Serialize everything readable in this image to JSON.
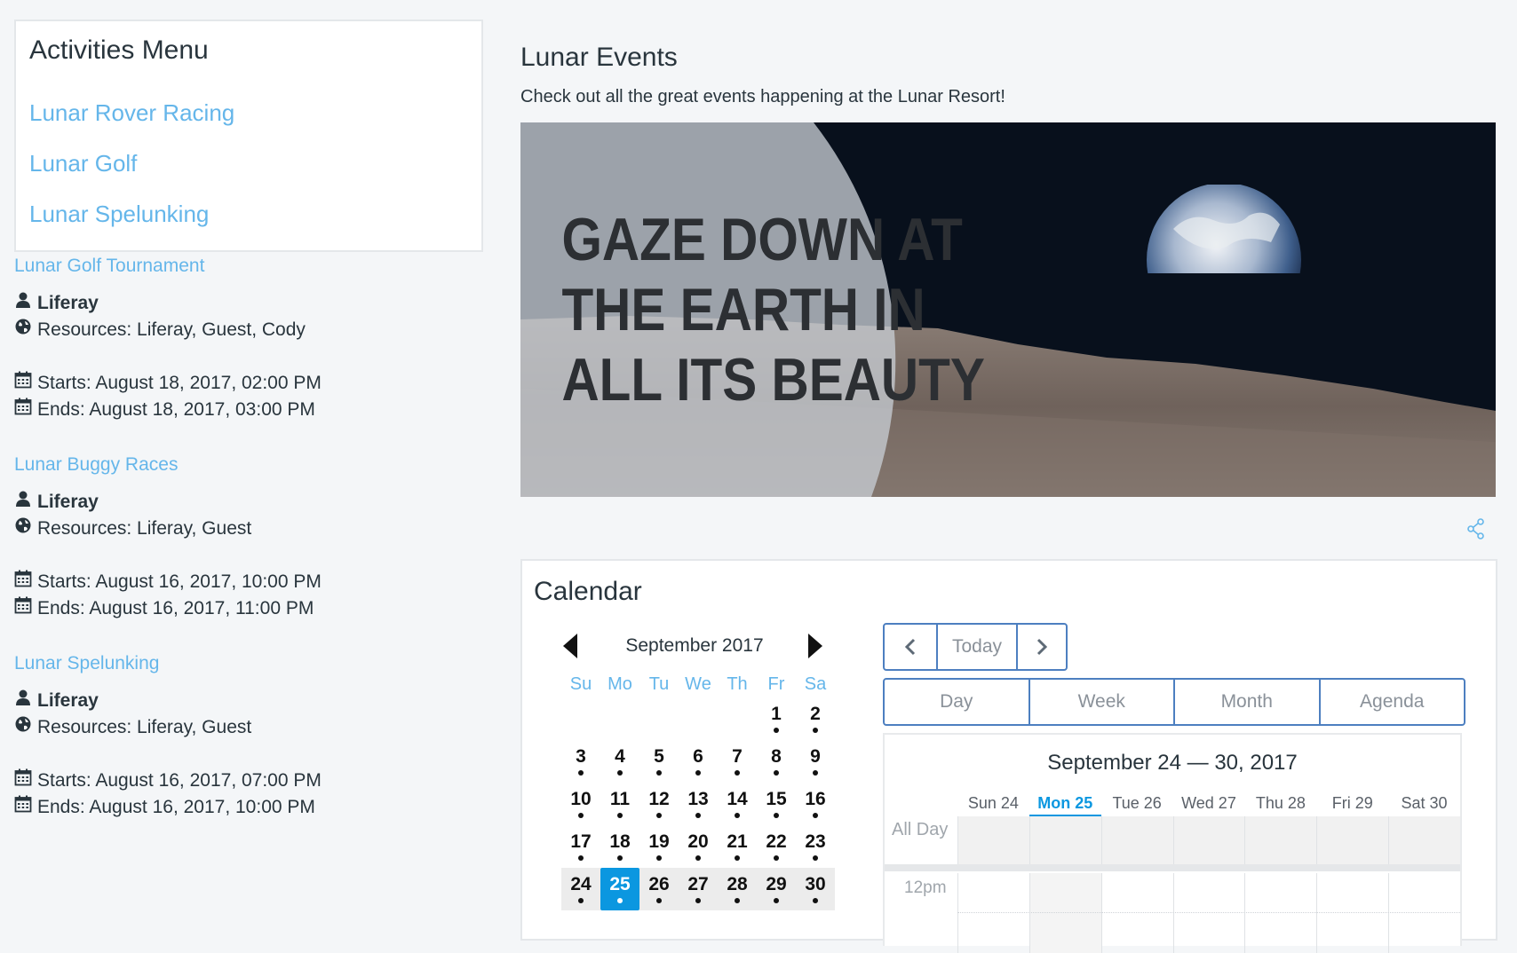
{
  "activities_menu": {
    "title": "Activities Menu",
    "links": [
      "Lunar Rover Racing",
      "Lunar Golf",
      "Lunar Spelunking"
    ]
  },
  "events": [
    {
      "title": "Lunar Golf Tournament",
      "owner": "Liferay",
      "resources": "Resources: Liferay, Guest, Cody",
      "starts": "Starts: August 18, 2017, 02:00 PM",
      "ends": "Ends: August 18, 2017, 03:00 PM"
    },
    {
      "title": "Lunar Buggy Races",
      "owner": "Liferay",
      "resources": "Resources: Liferay, Guest",
      "starts": "Starts: August 16, 2017, 10:00 PM",
      "ends": "Ends: August 16, 2017, 11:00 PM"
    },
    {
      "title": "Lunar Spelunking",
      "owner": "Liferay",
      "resources": "Resources: Liferay, Guest",
      "starts": "Starts: August 16, 2017, 07:00 PM",
      "ends": "Ends: August 16, 2017, 10:00 PM"
    }
  ],
  "main": {
    "title": "Lunar Events",
    "description": "Check out all the great events happening at the Lunar Resort!",
    "banner": {
      "line1": "GAZE DOWN AT",
      "line2": "THE EARTH IN",
      "line3": "ALL ITS BEAUTY"
    }
  },
  "calendar": {
    "title": "Calendar",
    "mini": {
      "month": "September 2017",
      "weekdays": [
        "Su",
        "Mo",
        "Tu",
        "We",
        "Th",
        "Fr",
        "Sa"
      ],
      "leading_blanks": 5,
      "days": 30,
      "today": 25
    },
    "nav": {
      "today_label": "Today"
    },
    "views": [
      "Day",
      "Week",
      "Month",
      "Agenda"
    ],
    "active_view": "Week",
    "week": {
      "range": "September 24 — 30, 2017",
      "days": [
        "Sun 24",
        "Mon 25",
        "Tue 26",
        "Wed 27",
        "Thu 28",
        "Fri 29",
        "Sat 30"
      ],
      "today_index": 1,
      "all_day_label": "All Day",
      "hour_label": "12pm"
    }
  },
  "colors": {
    "link": "#65b6ea",
    "accent": "#0b97e0",
    "border_blue": "#4d7fc0"
  }
}
